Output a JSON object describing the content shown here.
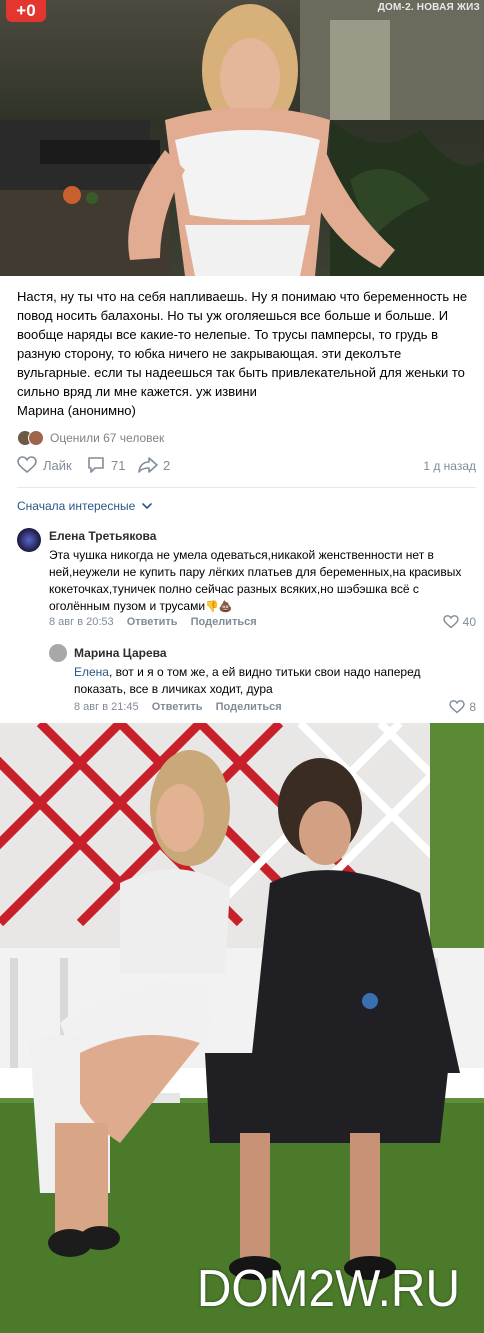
{
  "top_photo": {
    "logo_badge": "+0",
    "channel_tag": "ДОМ-2. НОВАЯ ЖИЗ"
  },
  "post": {
    "text": "Настя, ну ты что на себя напливаешь. Ну я понимаю что беременность не повод носить балахоны. Но ты уж оголяешься все больше и больше. И вообще наряды все какие-то нелепые. То трусы памперсы, то грудь в разную сторону, то юбка ничего не закрывающая. эти деколъте вульгарные. если ты надеешься так быть привлекательной для женьки то сильно вряд ли мне кажется. уж извини",
    "author": "Марина (анонимно)",
    "rated_by": "Оценили 67 человек",
    "actions": {
      "like_label": "Лайк",
      "comments_count": "71",
      "shares_count": "2",
      "time_ago": "1 д назад"
    }
  },
  "comments_section": {
    "sort_label": "Сначала интересные",
    "comments": [
      {
        "name": "Елена Третьякова",
        "text": "Эта чушка никогда не умела одеваться,никакой женственности нет в ней,неужели не купить пару лёгких платьев для беременных,на красивых кокеточках,туничек полно сейчас разных всяких,но шэбэшка всё с оголённым пузом и трусами",
        "emoji": "👎💩",
        "date": "8 авг в 20:53",
        "reply_label": "Ответить",
        "share_label": "Поделиться",
        "likes": "40"
      },
      {
        "name": "Марина Царева",
        "mention": "Елена",
        "text": ", вот и я о том же, а ей видно титьки свои надо наперед показать, все в личиках ходит, дура",
        "date": "8 авг в 21:45",
        "reply_label": "Ответить",
        "share_label": "Поделиться",
        "likes": "8"
      }
    ]
  },
  "bottom_photo": {
    "watermark": "DOM2W.RU"
  },
  "colors": {
    "link": "#2a5885",
    "secondary": "#818c99",
    "badge_red": "#e2362e"
  }
}
